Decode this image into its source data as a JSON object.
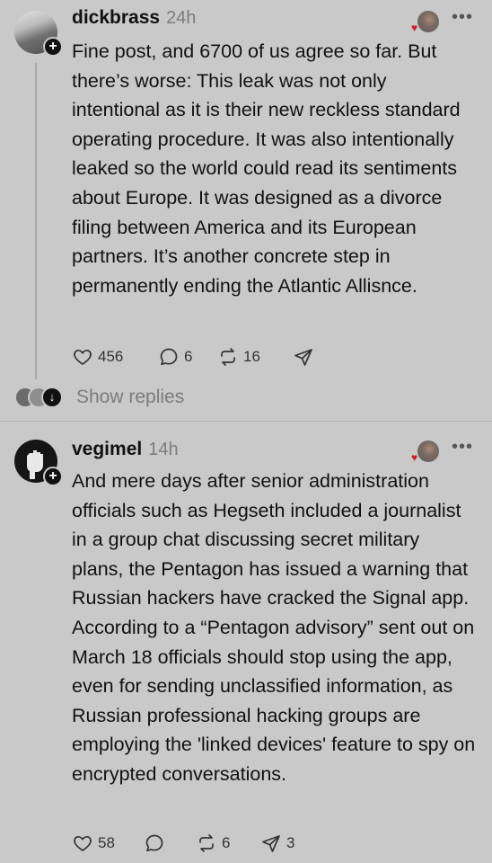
{
  "posts": [
    {
      "username": "dickbrass",
      "time": "24h",
      "text": "Fine post, and 6700 of us agree so far. But there’s worse: This leak was not only intentional as it is their new reckless standard operating procedure. It was also intentionally leaked so the world could read its sentiments about Europe. It was designed as a divorce filing between America and its European partners. It’s another concrete step in permanently ending the Atlantic Allisnce.",
      "likes": "456",
      "comments": "6",
      "reposts": "16",
      "shares": "",
      "show_replies": "Show replies"
    },
    {
      "username": "vegimel",
      "time": "14h",
      "text": "And mere days after senior administration officials such as Hegseth included a journalist in a group chat discussing secret military plans, the Pentagon has issued a warning that Russian hackers have cracked the Signal app. According to a “Pentagon advisory” sent out on March 18 officials should stop using the app, even for sending unclassified information, as Russian professional hacking groups are employing the 'linked devices' feature to spy on encrypted conversations.",
      "likes": "58",
      "comments": "",
      "reposts": "6",
      "shares": "3"
    }
  ],
  "icons": {
    "follow": "+",
    "more": "•••",
    "heart": "heart-icon",
    "comment": "comment-icon",
    "repost": "repost-icon",
    "share": "share-icon",
    "liked": "♥",
    "down": "↓"
  },
  "colors": {
    "background": "#c9c9c9",
    "text": "#111111",
    "muted": "#7b7b7b",
    "liked_heart": "#c9202c"
  }
}
